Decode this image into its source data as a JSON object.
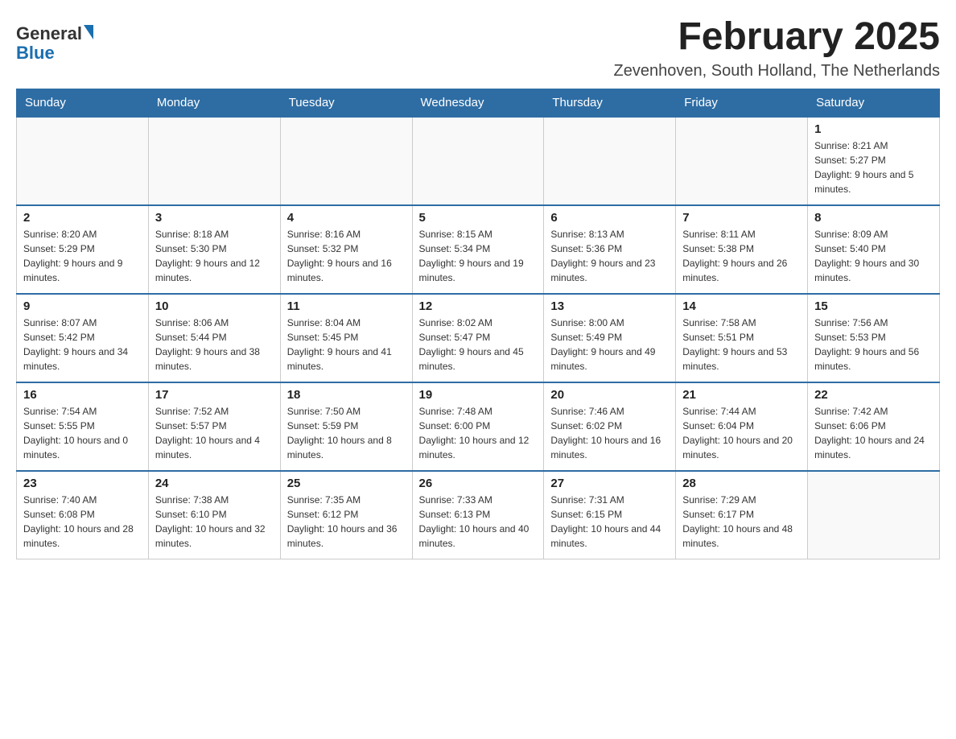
{
  "header": {
    "logo_general": "General",
    "logo_blue": "Blue",
    "month_title": "February 2025",
    "location": "Zevenhoven, South Holland, The Netherlands"
  },
  "days_of_week": [
    "Sunday",
    "Monday",
    "Tuesday",
    "Wednesday",
    "Thursday",
    "Friday",
    "Saturday"
  ],
  "weeks": [
    [
      {
        "day": "",
        "info": ""
      },
      {
        "day": "",
        "info": ""
      },
      {
        "day": "",
        "info": ""
      },
      {
        "day": "",
        "info": ""
      },
      {
        "day": "",
        "info": ""
      },
      {
        "day": "",
        "info": ""
      },
      {
        "day": "1",
        "info": "Sunrise: 8:21 AM\nSunset: 5:27 PM\nDaylight: 9 hours and 5 minutes."
      }
    ],
    [
      {
        "day": "2",
        "info": "Sunrise: 8:20 AM\nSunset: 5:29 PM\nDaylight: 9 hours and 9 minutes."
      },
      {
        "day": "3",
        "info": "Sunrise: 8:18 AM\nSunset: 5:30 PM\nDaylight: 9 hours and 12 minutes."
      },
      {
        "day": "4",
        "info": "Sunrise: 8:16 AM\nSunset: 5:32 PM\nDaylight: 9 hours and 16 minutes."
      },
      {
        "day": "5",
        "info": "Sunrise: 8:15 AM\nSunset: 5:34 PM\nDaylight: 9 hours and 19 minutes."
      },
      {
        "day": "6",
        "info": "Sunrise: 8:13 AM\nSunset: 5:36 PM\nDaylight: 9 hours and 23 minutes."
      },
      {
        "day": "7",
        "info": "Sunrise: 8:11 AM\nSunset: 5:38 PM\nDaylight: 9 hours and 26 minutes."
      },
      {
        "day": "8",
        "info": "Sunrise: 8:09 AM\nSunset: 5:40 PM\nDaylight: 9 hours and 30 minutes."
      }
    ],
    [
      {
        "day": "9",
        "info": "Sunrise: 8:07 AM\nSunset: 5:42 PM\nDaylight: 9 hours and 34 minutes."
      },
      {
        "day": "10",
        "info": "Sunrise: 8:06 AM\nSunset: 5:44 PM\nDaylight: 9 hours and 38 minutes."
      },
      {
        "day": "11",
        "info": "Sunrise: 8:04 AM\nSunset: 5:45 PM\nDaylight: 9 hours and 41 minutes."
      },
      {
        "day": "12",
        "info": "Sunrise: 8:02 AM\nSunset: 5:47 PM\nDaylight: 9 hours and 45 minutes."
      },
      {
        "day": "13",
        "info": "Sunrise: 8:00 AM\nSunset: 5:49 PM\nDaylight: 9 hours and 49 minutes."
      },
      {
        "day": "14",
        "info": "Sunrise: 7:58 AM\nSunset: 5:51 PM\nDaylight: 9 hours and 53 minutes."
      },
      {
        "day": "15",
        "info": "Sunrise: 7:56 AM\nSunset: 5:53 PM\nDaylight: 9 hours and 56 minutes."
      }
    ],
    [
      {
        "day": "16",
        "info": "Sunrise: 7:54 AM\nSunset: 5:55 PM\nDaylight: 10 hours and 0 minutes."
      },
      {
        "day": "17",
        "info": "Sunrise: 7:52 AM\nSunset: 5:57 PM\nDaylight: 10 hours and 4 minutes."
      },
      {
        "day": "18",
        "info": "Sunrise: 7:50 AM\nSunset: 5:59 PM\nDaylight: 10 hours and 8 minutes."
      },
      {
        "day": "19",
        "info": "Sunrise: 7:48 AM\nSunset: 6:00 PM\nDaylight: 10 hours and 12 minutes."
      },
      {
        "day": "20",
        "info": "Sunrise: 7:46 AM\nSunset: 6:02 PM\nDaylight: 10 hours and 16 minutes."
      },
      {
        "day": "21",
        "info": "Sunrise: 7:44 AM\nSunset: 6:04 PM\nDaylight: 10 hours and 20 minutes."
      },
      {
        "day": "22",
        "info": "Sunrise: 7:42 AM\nSunset: 6:06 PM\nDaylight: 10 hours and 24 minutes."
      }
    ],
    [
      {
        "day": "23",
        "info": "Sunrise: 7:40 AM\nSunset: 6:08 PM\nDaylight: 10 hours and 28 minutes."
      },
      {
        "day": "24",
        "info": "Sunrise: 7:38 AM\nSunset: 6:10 PM\nDaylight: 10 hours and 32 minutes."
      },
      {
        "day": "25",
        "info": "Sunrise: 7:35 AM\nSunset: 6:12 PM\nDaylight: 10 hours and 36 minutes."
      },
      {
        "day": "26",
        "info": "Sunrise: 7:33 AM\nSunset: 6:13 PM\nDaylight: 10 hours and 40 minutes."
      },
      {
        "day": "27",
        "info": "Sunrise: 7:31 AM\nSunset: 6:15 PM\nDaylight: 10 hours and 44 minutes."
      },
      {
        "day": "28",
        "info": "Sunrise: 7:29 AM\nSunset: 6:17 PM\nDaylight: 10 hours and 48 minutes."
      },
      {
        "day": "",
        "info": ""
      }
    ]
  ]
}
